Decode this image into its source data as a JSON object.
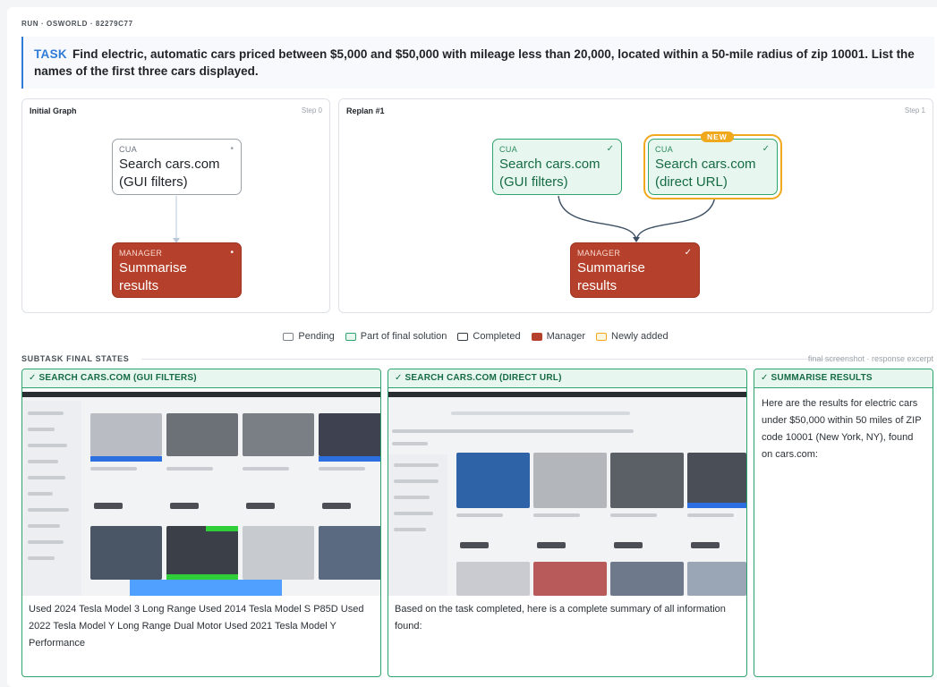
{
  "run_label": "RUN · OSWORLD · 82279C77",
  "task": {
    "tag": "TASK",
    "text": "Find electric, automatic cars priced between $5,000 and $50,000 with mileage less than 20,000, located within a 50-mile radius of zip 10001. List the names of the first three cars displayed."
  },
  "initial_graph": {
    "title": "Initial Graph",
    "step": "Step 0",
    "nodes": [
      {
        "kind": "CUA",
        "title_line1": "Search cars.com",
        "title_line2": "(GUI filters)",
        "mark": "•"
      },
      {
        "kind": "MANAGER",
        "title_line1": "Summarise",
        "title_line2": "results",
        "mark": "•"
      }
    ]
  },
  "replan": {
    "title": "Replan #1",
    "step": "Step 1",
    "new_badge": "NEW",
    "nodes": [
      {
        "kind": "CUA",
        "title_line1": "Search cars.com",
        "title_line2": "(GUI filters)",
        "mark": "✓"
      },
      {
        "kind": "CUA",
        "title_line1": "Search cars.com",
        "title_line2": "(direct URL)",
        "mark": "✓"
      },
      {
        "kind": "MANAGER",
        "title_line1": "Summarise",
        "title_line2": "results",
        "mark": "✓"
      }
    ]
  },
  "legend": [
    {
      "label": "Pending",
      "swatch": "pending"
    },
    {
      "label": "Part of final solution",
      "swatch": "final"
    },
    {
      "label": "Completed",
      "swatch": "completed"
    },
    {
      "label": "Manager",
      "swatch": "manager"
    },
    {
      "label": "Newly added",
      "swatch": "new"
    }
  ],
  "section": {
    "label": "SUBTASK FINAL STATES",
    "note": "final screenshot · response excerpt"
  },
  "cards": [
    {
      "title": "✓ SEARCH CARS.COM (GUI FILTERS)",
      "excerpt": "Used 2024 Tesla Model 3 Long Range Used 2014 Tesla Model S P85D Used 2022 Tesla Model Y Long Range Dual Motor Used 2021 Tesla Model Y Performance"
    },
    {
      "title": "✓ SEARCH CARS.COM (DIRECT URL)",
      "excerpt": "Based on the task completed, here is a complete summary of all information found:"
    },
    {
      "title": "✓ SUMMARISE RESULTS",
      "excerpt": "Here are the results for electric cars under $50,000 within 50 miles of ZIP code 10001 (New York, NY), found on cars.com:"
    }
  ],
  "colors": {
    "task_accent": "#2f7bd8",
    "final_green": "#2fa36d",
    "manager_red": "#b5402b",
    "new_orange": "#f0a81c"
  }
}
